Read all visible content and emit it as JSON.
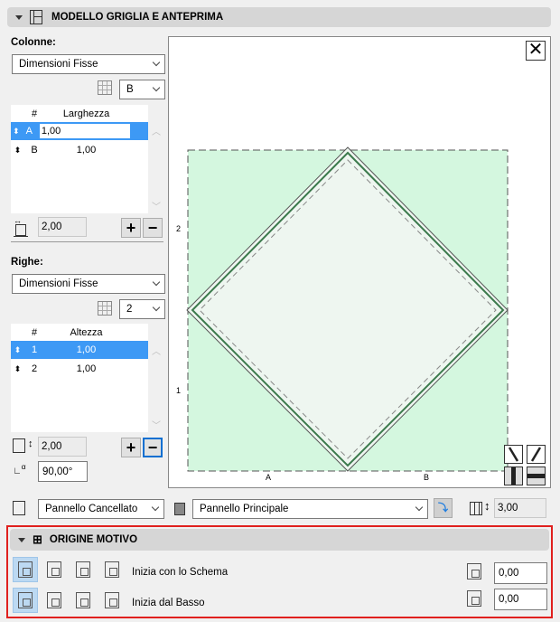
{
  "section1": {
    "title": "MODELLO GRIGLIA E ANTEPRIMA"
  },
  "columns": {
    "label": "Colonne:",
    "mode": "Dimensioni Fisse",
    "count": "B",
    "header_hash": "#",
    "header_value": "Larghezza",
    "rows": [
      {
        "id": "A",
        "value": "1,00",
        "selected": true
      },
      {
        "id": "B",
        "value": "1,00",
        "selected": false
      }
    ],
    "total": "2,00"
  },
  "rows": {
    "label": "Righe:",
    "mode": "Dimensioni Fisse",
    "count": "2",
    "header_hash": "#",
    "header_value": "Altezza",
    "rows": [
      {
        "id": "1",
        "value": "1,00",
        "selected": true
      },
      {
        "id": "2",
        "value": "1,00",
        "selected": false
      }
    ],
    "total": "2,00",
    "angle": "90,00°"
  },
  "preview": {
    "col_labels": [
      "A",
      "B"
    ],
    "row_labels": [
      "2",
      "1"
    ]
  },
  "bottom": {
    "panel_type": "Pannello Cancellato",
    "panel_main": "Pannello Principale",
    "height": "3,00"
  },
  "section2": {
    "title": "ORIGINE MOTIVO",
    "row1_label": "Inizia con lo Schema",
    "row2_label": "Inizia dal Basso",
    "x_offset": "0,00",
    "y_offset": "0,00"
  }
}
